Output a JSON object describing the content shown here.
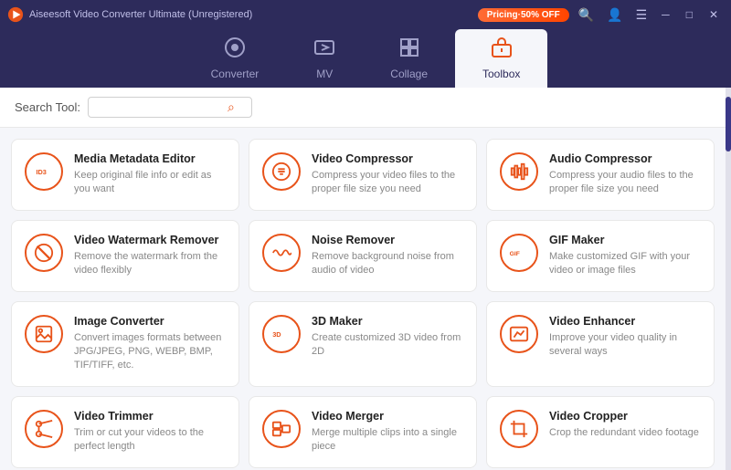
{
  "titleBar": {
    "appName": "Aiseesoft Video Converter Ultimate (Unregistered)",
    "pricingBtn": "Pricing·50% OFF",
    "icons": [
      "search",
      "user",
      "menu",
      "minimize",
      "maximize",
      "close"
    ]
  },
  "navTabs": [
    {
      "id": "converter",
      "label": "Converter",
      "icon": "converter"
    },
    {
      "id": "mv",
      "label": "MV",
      "icon": "mv"
    },
    {
      "id": "collage",
      "label": "Collage",
      "icon": "collage"
    },
    {
      "id": "toolbox",
      "label": "Toolbox",
      "icon": "toolbox",
      "active": true
    }
  ],
  "searchBar": {
    "label": "Search Tool:",
    "placeholder": ""
  },
  "tools": [
    {
      "id": "media-metadata-editor",
      "name": "Media Metadata Editor",
      "desc": "Keep original file info or edit as you want",
      "iconType": "id3"
    },
    {
      "id": "video-compressor",
      "name": "Video Compressor",
      "desc": "Compress your video files to the proper file size you need",
      "iconType": "compressor"
    },
    {
      "id": "audio-compressor",
      "name": "Audio Compressor",
      "desc": "Compress your audio files to the proper file size you need",
      "iconType": "audio-compressor"
    },
    {
      "id": "video-watermark-remover",
      "name": "Video Watermark Remover",
      "desc": "Remove the watermark from the video flexibly",
      "iconType": "watermark"
    },
    {
      "id": "noise-remover",
      "name": "Noise Remover",
      "desc": "Remove background noise from audio of video",
      "iconType": "noise"
    },
    {
      "id": "gif-maker",
      "name": "GIF Maker",
      "desc": "Make customized GIF with your video or image files",
      "iconType": "gif"
    },
    {
      "id": "image-converter",
      "name": "Image Converter",
      "desc": "Convert images formats between JPG/JPEG, PNG, WEBP, BMP, TIF/TIFF, etc.",
      "iconType": "image"
    },
    {
      "id": "3d-maker",
      "name": "3D Maker",
      "desc": "Create customized 3D video from 2D",
      "iconType": "3d"
    },
    {
      "id": "video-enhancer",
      "name": "Video Enhancer",
      "desc": "Improve your video quality in several ways",
      "iconType": "enhancer"
    },
    {
      "id": "video-trimmer",
      "name": "Video Trimmer",
      "desc": "Trim or cut your videos to the perfect length",
      "iconType": "trimmer"
    },
    {
      "id": "video-merger",
      "name": "Video Merger",
      "desc": "Merge multiple clips into a single piece",
      "iconType": "merger"
    },
    {
      "id": "video-cropper",
      "name": "Video Cropper",
      "desc": "Crop the redundant video footage",
      "iconType": "cropper"
    }
  ]
}
